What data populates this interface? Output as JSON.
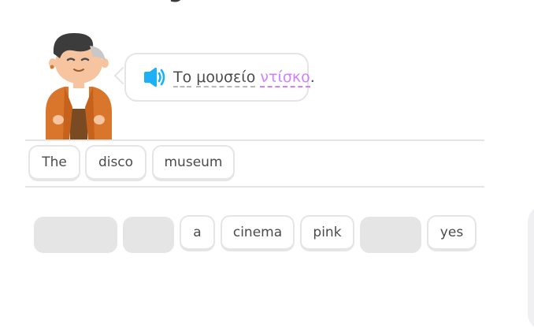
{
  "prompt": {
    "speaker_icon": "speaker-icon",
    "sentence_words": [
      "Το",
      "μουσείο",
      "ντίσκο"
    ],
    "sentence_punct": ".",
    "new_word_color": "#ce82ff",
    "speaker_color": "#1cb0f6"
  },
  "answer_tiles": [
    "The",
    "disco",
    "museum"
  ],
  "word_bank": {
    "visible_tiles": [
      "a",
      "cinema",
      "pink",
      "yes"
    ]
  },
  "colors": {
    "border": "#e5e5e5",
    "text": "#4b4b4b",
    "slot": "#e5e5e5"
  }
}
